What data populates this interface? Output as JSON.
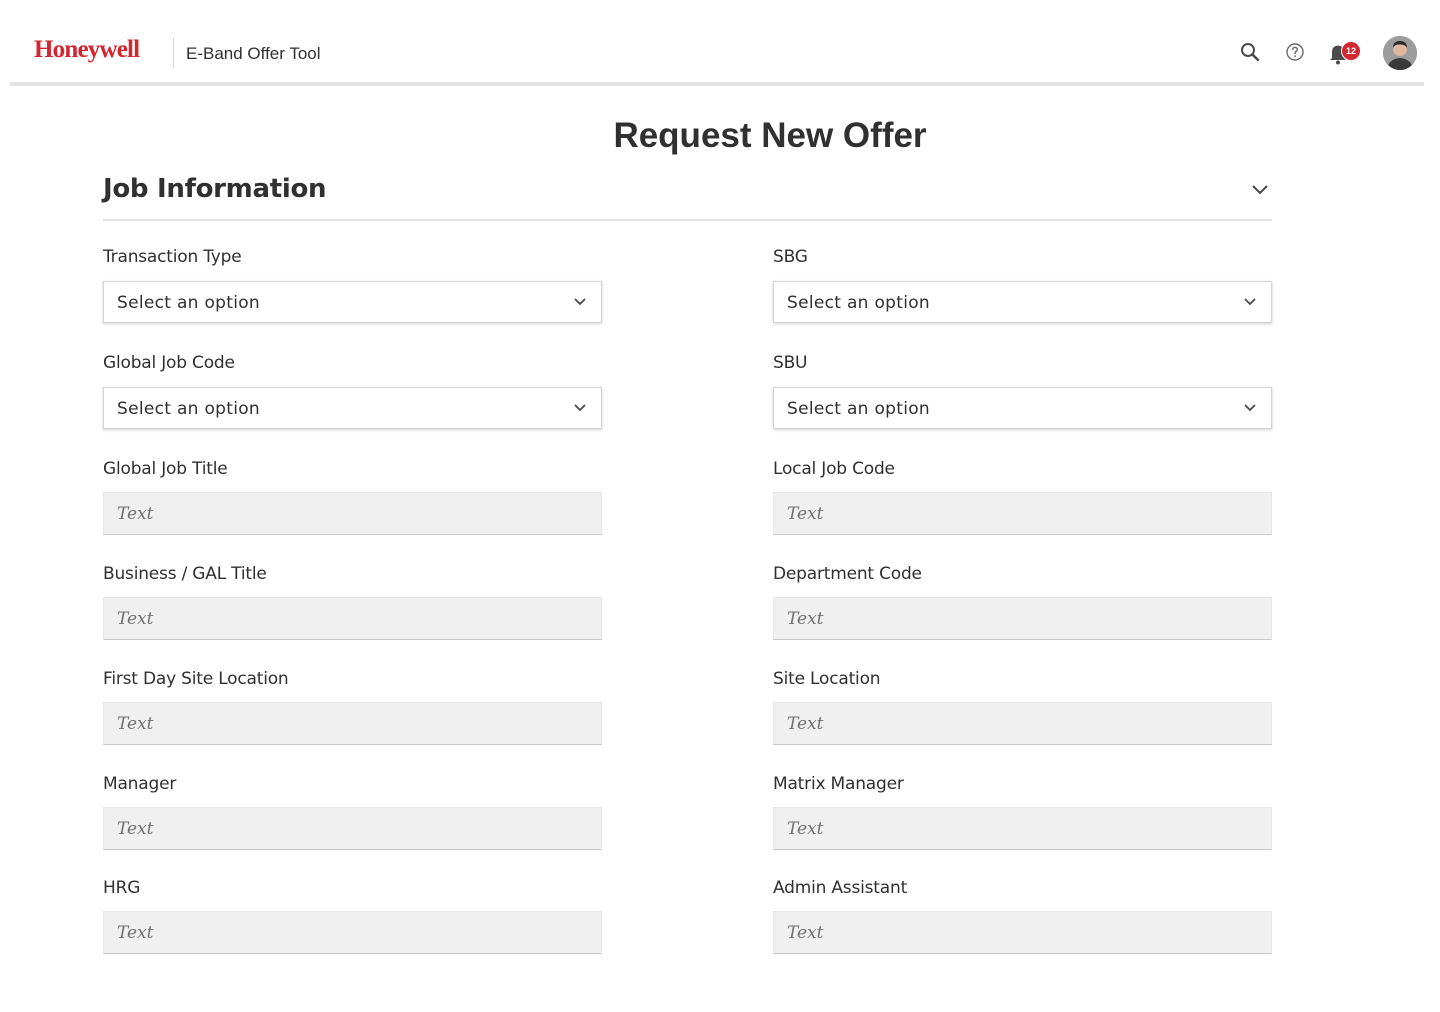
{
  "header": {
    "logo": "Honeywell",
    "app_title": "E-Band Offer Tool",
    "notification_count": "12",
    "icons": [
      "search-icon",
      "help-icon",
      "bell-icon"
    ]
  },
  "page": {
    "title": "Request New Offer"
  },
  "section": {
    "title": "Job Information"
  },
  "colors": {
    "brand": "#d22630",
    "text": "#303030",
    "input_bg": "#f0f0f0"
  },
  "fields": {
    "transaction_type": {
      "label": "Transaction Type",
      "value": "Select an option"
    },
    "sbg": {
      "label": "SBG",
      "value": "Select an option"
    },
    "global_job_code": {
      "label": "Global Job Code",
      "value": "Select an option"
    },
    "sbu": {
      "label": "SBU",
      "value": "Select an option"
    },
    "global_job_title": {
      "label": "Global Job Title",
      "placeholder": "Text"
    },
    "local_job_code": {
      "label": "Local Job Code",
      "placeholder": "Text"
    },
    "business_gal_title": {
      "label": "Business / GAL Title",
      "placeholder": "Text"
    },
    "department_code": {
      "label": "Department Code",
      "placeholder": "Text"
    },
    "first_day_site_location": {
      "label": "First Day Site Location",
      "placeholder": "Text"
    },
    "site_location": {
      "label": "Site Location",
      "placeholder": "Text"
    },
    "manager": {
      "label": "Manager",
      "placeholder": "Text"
    },
    "matrix_manager": {
      "label": "Matrix Manager",
      "placeholder": "Text"
    },
    "hrg": {
      "label": "HRG",
      "placeholder": "Text"
    },
    "admin_assistant": {
      "label": "Admin Assistant",
      "placeholder": "Text"
    }
  }
}
